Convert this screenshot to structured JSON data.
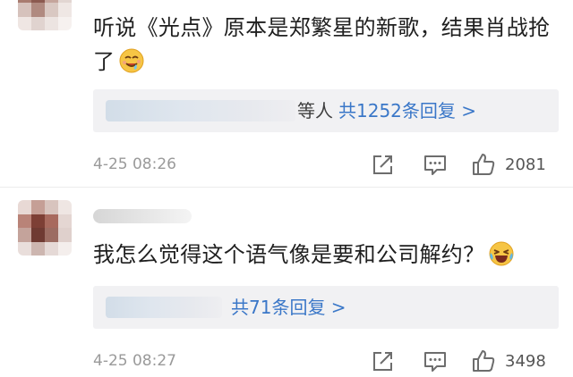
{
  "comments": [
    {
      "text": "听说《光点》原本是郑繁星的新歌，结果肖战抢了",
      "emoji": "drooling-face-emoji",
      "reply_prefix": "等人",
      "reply_link": "共1252条回复 >",
      "timestamp": "4-25 08:26",
      "likes": "2081"
    },
    {
      "text": "我怎么觉得这个语气像是要和公司解约？",
      "emoji": "laughing-tears-emoji",
      "reply_link": "共71条回复 >",
      "timestamp": "4-25 08:27",
      "likes": "3498"
    }
  ],
  "icons": {
    "share": "share-icon",
    "comment": "comment-icon",
    "like": "like-icon"
  },
  "colors": {
    "link": "#3a77c8",
    "reply_background": "#f1f1f3",
    "meta_text": "#9a9a9a"
  }
}
